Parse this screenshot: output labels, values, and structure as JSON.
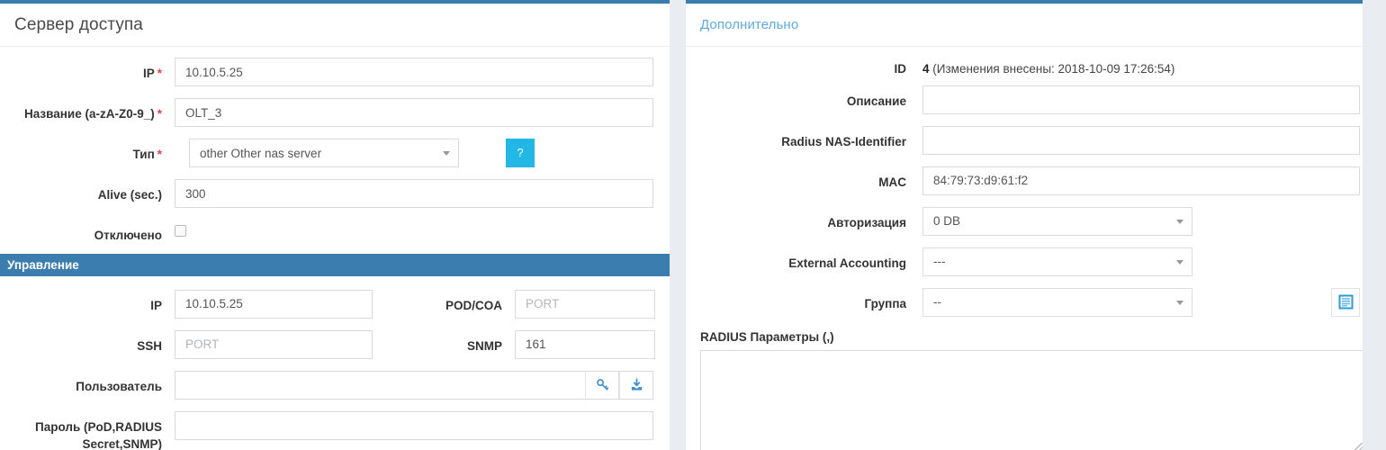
{
  "theme": {
    "accent_blue": "#3c7db0",
    "link_blue": "#5eaade",
    "help_btn_cyan": "#23b7e5",
    "required_red": "#e8413b",
    "page_bg": "#e9edf2",
    "section_bar_bg": "#3c7db0"
  },
  "left_panel": {
    "title": "Сервер доступа",
    "fields": {
      "ip": {
        "label": "IP",
        "required": true,
        "value": "10.10.5.25"
      },
      "name": {
        "label": "Название (a-zA-Z0-9_)",
        "required": true,
        "value": "OLT_3"
      },
      "type": {
        "label": "Тип",
        "required": true,
        "value": "other Other nas server",
        "help_label": "?"
      },
      "alive": {
        "label": "Alive (sec.)",
        "required": false,
        "value": "300"
      },
      "disabled": {
        "label": "Отключено",
        "checked": false
      }
    },
    "section": {
      "title": "Управление",
      "fields": {
        "ip": {
          "label": "IP",
          "value": "10.10.5.25"
        },
        "pod_coa": {
          "label": "POD/COA",
          "value": "",
          "placeholder": "PORT"
        },
        "ssh": {
          "label": "SSH",
          "value": "",
          "placeholder": "PORT"
        },
        "snmp": {
          "label": "SNMP",
          "value": "161"
        },
        "user": {
          "label": "Пользователь",
          "value": "",
          "placeholder": ""
        },
        "password": {
          "label": "Пароль (PoD,RADIUS Secret,SNMP)",
          "value": "",
          "placeholder": ""
        }
      },
      "icons": {
        "key": "key-icon",
        "import": "import-download-icon"
      }
    }
  },
  "right_panel": {
    "title": "Дополнительно",
    "fields": {
      "id": {
        "label": "ID",
        "value": "4",
        "meta": "(Изменения внесены: 2018-10-09 17:26:54)"
      },
      "description": {
        "label": "Описание",
        "value": "",
        "placeholder": ""
      },
      "radius_nas_identifier": {
        "label": "Radius NAS-Identifier",
        "value": "",
        "placeholder": ""
      },
      "mac": {
        "label": "MAC",
        "value": "84:79:73:d9:61:f2"
      },
      "authorization": {
        "label": "Авторизация",
        "value": "0 DB"
      },
      "external_accounting": {
        "label": "External Accounting",
        "value": "---"
      },
      "group": {
        "label": "Группа",
        "value": "--",
        "picker_icon": "list-document-icon"
      },
      "radius_params": {
        "label": "RADIUS Параметры (,)",
        "value": ""
      }
    }
  }
}
